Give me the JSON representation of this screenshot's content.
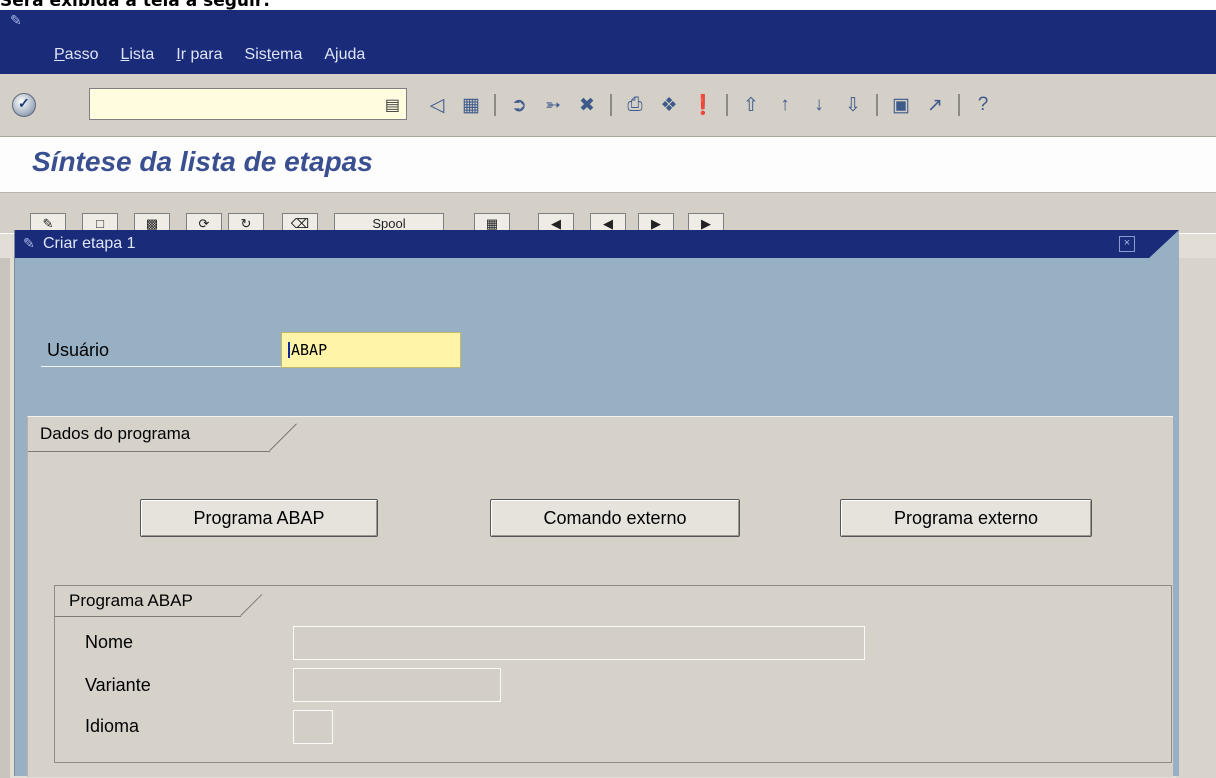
{
  "caption": "Será exibida a tela a seguir:",
  "menu": {
    "items": [
      {
        "pre": "",
        "u": "P",
        "post": "asso"
      },
      {
        "pre": "",
        "u": "L",
        "post": "ista"
      },
      {
        "pre": "",
        "u": "I",
        "post": "r para"
      },
      {
        "pre": "Sis",
        "u": "t",
        "post": "ema"
      },
      {
        "pre": "A",
        "u": "j",
        "post": "uda"
      }
    ]
  },
  "toolbar": {
    "command_value": "",
    "icons": [
      "enter-icon",
      "back-icon",
      "save-icon",
      "sep",
      "exit-icon",
      "up-icon",
      "cancel-icon",
      "sep",
      "print-icon",
      "find-icon",
      "find-next-icon",
      "sep",
      "first-page-icon",
      "prev-page-icon",
      "next-page-icon",
      "last-page-icon",
      "sep",
      "new-session-icon",
      "shortcut-icon",
      "sep",
      "help-icon"
    ]
  },
  "page": {
    "title": "Síntese da lista de etapas"
  },
  "appbar": {
    "spool_label": "Spool"
  },
  "dialog": {
    "title": "Criar etapa 1",
    "user_label": "Usuário",
    "user_value": "ABAP",
    "program_group": "Dados do programa",
    "buttons": {
      "abap": "Programa ABAP",
      "external_command": "Comando externo",
      "external_program": "Programa externo"
    },
    "abap_group": "Programa ABAP",
    "fields": {
      "name_label": "Nome",
      "name_value": "",
      "variant_label": "Variante",
      "variant_value": "",
      "language_label": "Idioma",
      "language_value": ""
    }
  },
  "colors": {
    "menubar": "#1a2b79",
    "dialog_bg": "#97b0c4",
    "title_text": "#3a4f8f",
    "input_highlight": "#fff4a8"
  }
}
